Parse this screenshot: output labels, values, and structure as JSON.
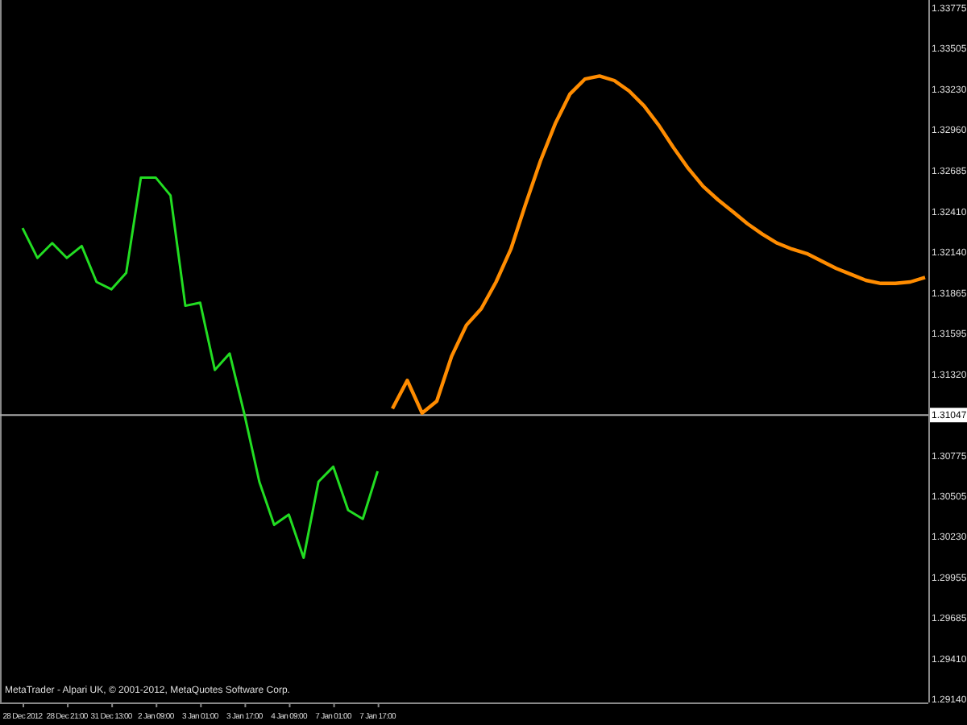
{
  "chart": {
    "copyright": "MetaTrader - Alpari UK, © 2001-2012, MetaQuotes Software Corp.",
    "chart_data": {
      "type": "line",
      "categories": [
        "28 Dec 2012",
        null,
        null,
        "28 Dec 21:00",
        null,
        null,
        "31 Dec 13:00",
        null,
        null,
        "2 Jan 09:00",
        null,
        null,
        "3 Jan 01:00",
        null,
        null,
        "3 Jan 17:00",
        null,
        null,
        "4 Jan 09:00",
        null,
        null,
        "7 Jan 01:00",
        null,
        null,
        "7 Jan 17:00",
        null,
        null,
        null,
        null,
        null,
        null,
        null,
        null,
        null,
        null,
        null,
        null,
        null,
        null,
        null,
        null,
        null,
        null,
        null,
        null,
        null,
        null,
        null,
        null,
        null,
        null,
        null,
        null,
        null,
        null,
        null,
        null,
        null,
        null,
        null,
        null,
        null
      ],
      "series": [
        {
          "color": "#22dd22",
          "values": [
            1.323,
            1.321,
            1.322,
            1.321,
            1.3218,
            1.3194,
            1.3189,
            1.32,
            1.3264,
            1.3264,
            1.3252,
            1.3178,
            1.318,
            1.3135,
            1.3146,
            1.3105,
            1.306,
            1.3031,
            1.3038,
            1.3009,
            1.306,
            1.307,
            1.3041,
            1.3035,
            1.3067,
            null,
            null,
            null,
            null,
            null,
            null,
            null,
            null,
            null,
            null,
            null,
            null,
            null,
            null,
            null,
            null,
            null,
            null,
            null,
            null,
            null,
            null,
            null,
            null,
            null,
            null,
            null,
            null,
            null,
            null,
            null,
            null,
            null,
            null,
            null,
            null,
            null
          ]
        },
        {
          "color": "#ff8c00",
          "values": [
            null,
            null,
            null,
            null,
            null,
            null,
            null,
            null,
            null,
            null,
            null,
            null,
            null,
            null,
            null,
            null,
            null,
            null,
            null,
            null,
            null,
            null,
            null,
            null,
            null,
            1.3109,
            1.3128,
            1.3106,
            1.3114,
            1.3144,
            1.3165,
            1.3176,
            1.3194,
            1.3216,
            1.3246,
            1.3275,
            1.33,
            1.332,
            1.333,
            1.3332,
            1.3329,
            1.3322,
            1.3312,
            1.3299,
            1.3284,
            1.327,
            1.3258,
            1.3249,
            1.3241,
            1.3233,
            1.3226,
            1.322,
            1.3216,
            1.3213,
            1.3208,
            1.3203,
            1.3199,
            1.3195,
            1.3193,
            1.3193,
            1.3194,
            1.3197
          ]
        }
      ],
      "ylim": [
        1.2912,
        1.3383
      ],
      "yticks": [
        {
          "value": 1.33775,
          "label": "1.33775"
        },
        {
          "value": 1.33505,
          "label": "1.33505"
        },
        {
          "value": 1.3323,
          "label": "1.33230"
        },
        {
          "value": 1.3296,
          "label": "1.32960"
        },
        {
          "value": 1.32685,
          "label": "1.32685"
        },
        {
          "value": 1.3241,
          "label": "1.32410"
        },
        {
          "value": 1.3214,
          "label": "1.32140"
        },
        {
          "value": 1.31865,
          "label": "1.31865"
        },
        {
          "value": 1.31595,
          "label": "1.31595"
        },
        {
          "value": 1.3132,
          "label": "1.31320"
        },
        {
          "value": 1.30775,
          "label": "1.30775"
        },
        {
          "value": 1.30505,
          "label": "1.30505"
        },
        {
          "value": 1.3023,
          "label": "1.30230"
        },
        {
          "value": 1.29955,
          "label": "1.29955"
        },
        {
          "value": 1.29685,
          "label": "1.29685"
        },
        {
          "value": 1.2941,
          "label": "1.29410"
        },
        {
          "value": 1.2914,
          "label": "1.29140"
        }
      ],
      "ref_lines": [
        {
          "axis": "y",
          "value": 1.31047,
          "label": "1.31047"
        }
      ]
    }
  }
}
